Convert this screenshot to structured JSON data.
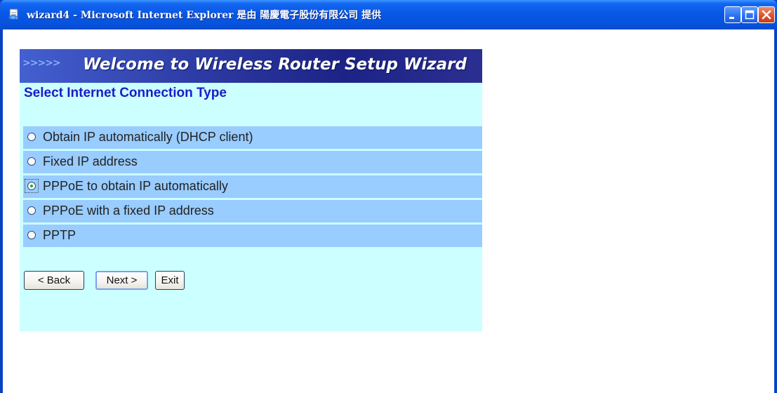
{
  "window": {
    "title": "wizard4 - Microsoft Internet Explorer 是由 陽慶電子股份有限公司 提供",
    "icons": [
      "ie-page-icon",
      "minimize-icon",
      "maximize-icon",
      "close-icon"
    ]
  },
  "banner": {
    "arrows": ">>>>>",
    "title": "Welcome to Wireless Router Setup Wizard"
  },
  "section": {
    "title": "Select Internet Connection Type"
  },
  "options": [
    {
      "label": "Obtain IP automatically (DHCP client)",
      "checked": false
    },
    {
      "label": "Fixed IP address",
      "checked": false
    },
    {
      "label": "PPPoE to obtain IP automatically",
      "checked": true
    },
    {
      "label": "PPPoE with a fixed IP address",
      "checked": false
    },
    {
      "label": "PPTP",
      "checked": false
    }
  ],
  "buttons": {
    "back": "< Back",
    "next": "Next >",
    "exit": "Exit"
  },
  "colors": {
    "panel_bg": "#ccffff",
    "row_bg": "#99ccff",
    "section_title": "#1b1cc7",
    "titlebar": "#0858e6"
  }
}
